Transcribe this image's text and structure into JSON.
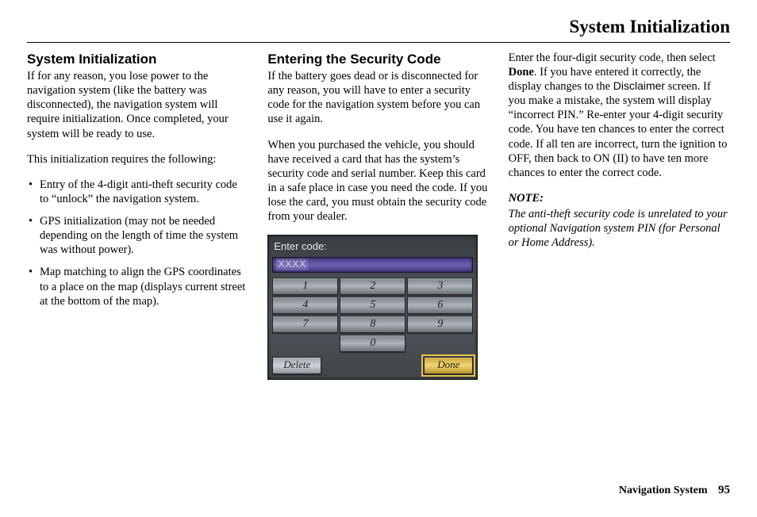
{
  "header": {
    "title": "System Initialization"
  },
  "col1": {
    "heading": "System Initialization",
    "p1": "If for any reason, you lose power to the navigation system (like the battery was disconnected), the navigation system will require initialization. Once completed, your system will be ready to use.",
    "p2": "This initialization requires the following:",
    "bullets": [
      "Entry of the 4-digit anti-theft security code to “unlock” the navigation system.",
      "GPS initialization (may not be needed depending on the length of time the system was without power).",
      "Map matching to align the GPS coordinates to a place on the map (displays current street at the bottom of the map)."
    ]
  },
  "col2": {
    "heading": "Entering the Security Code",
    "p1": "If the battery goes dead or is disconnected for any reason, you will have to enter a security code for the navigation system before you can use it again.",
    "p2": "When you purchased the vehicle, you should have received a card that has the system’s security code and serial number. Keep this card in a safe place in case you need the code. If you lose the card, you must obtain the security code from your dealer."
  },
  "keypad": {
    "prompt": "Enter code:",
    "value": "XXXX",
    "keys": [
      "1",
      "2",
      "3",
      "4",
      "5",
      "6",
      "7",
      "8",
      "9",
      "0"
    ],
    "delete": "Delete",
    "done": "Done"
  },
  "col3": {
    "p1_a": "Enter the four-digit security code, then select ",
    "p1_bold": "Done",
    "p1_b": ". If you have entered it correctly, the display changes to the ",
    "p1_sans": "Disclaimer",
    "p1_c": " screen. If you make a mistake, the system will display “incorrect PIN.” Re-enter your 4-digit security code. You have ten chances to enter the correct code. If all ten are incorrect, turn the ignition to OFF, then back to ON (II) to have ten more chances to enter the correct code.",
    "note_label": "NOTE:",
    "note_body": "The anti-theft security code is unrelated to your optional Navigation system PIN (for Personal or Home Address)."
  },
  "footer": {
    "label": "Navigation System",
    "page": "95"
  }
}
